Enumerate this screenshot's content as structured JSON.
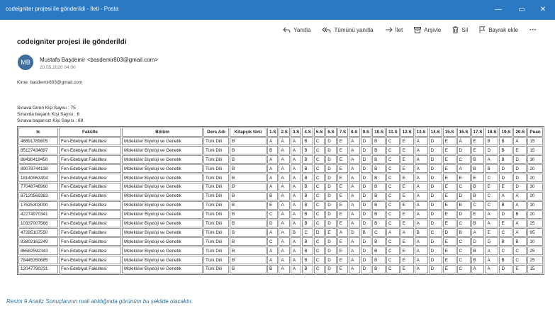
{
  "window": {
    "title": "codeigniter projesi ile gönderildi - İleti - Posta",
    "min_glyph": "—",
    "max_glyph": "▭",
    "close_glyph": "✕"
  },
  "toolbar": [
    {
      "label": "Yanıtla",
      "icon": "reply-icon"
    },
    {
      "label": "Tümünü yanıtla",
      "icon": "reply-all-icon"
    },
    {
      "label": "İlet",
      "icon": "forward-icon"
    },
    {
      "label": "Arşivle",
      "icon": "archive-icon"
    },
    {
      "label": "Sil",
      "icon": "trash-icon"
    },
    {
      "label": "Bayrak ekle",
      "icon": "flag-icon"
    },
    {
      "label": "···",
      "icon": "more-icon"
    }
  ],
  "message": {
    "subject": "codeigniter projesi ile gönderildi",
    "avatar_initials": "MB",
    "avatar_color": "#3d6e9f",
    "sender": "Mustafa Başdemir <basdemir803@gmail.com>",
    "date": "20.05.2020 04:00",
    "to": "Kime: basdemir803@gmail.com"
  },
  "summary": [
    "Sınava Giren Kişi Sayısı : 75",
    "Sınavda başarılı Kişi Sayısı : 6",
    "Sınava başarısız Kişi Sayısı : 69"
  ],
  "table": {
    "headers": [
      "tc",
      "Fakülte",
      "Bölüm",
      "Ders Adı",
      "Kitapçık türü",
      "1.S",
      "2.S",
      "3.S",
      "4.S",
      "5.S",
      "6.S",
      "7.S",
      "8.S",
      "9.S",
      "10.S",
      "11.S",
      "12.S",
      "13.S",
      "14.S",
      "15.S",
      "16.S",
      "17.S",
      "18.S",
      "19.S",
      "20.S",
      "Puan"
    ],
    "rows": [
      [
        "46891789805",
        "Fen-Edebiyat Fakültesi",
        "Moleküler Biyoloji ve Genetik",
        "Türk Dili",
        "B",
        "A",
        "A",
        "A",
        "B",
        "C",
        "D",
        "E",
        "A",
        "D",
        "B",
        "C",
        "E",
        "A",
        "D",
        "E",
        "A",
        "E",
        "B",
        "B",
        "A",
        "15"
      ],
      [
        "85127434897",
        "Fen-Edebiyat Fakültesi",
        "Moleküler Biyoloji ve Genetik",
        "Türk Dili",
        "B",
        "B",
        "A",
        "A",
        "B",
        "C",
        "D",
        "E",
        "A",
        "D",
        "B",
        "C",
        "E",
        "A",
        "D",
        "E",
        "D",
        "E",
        "D",
        "B",
        "E",
        "15"
      ],
      [
        "88430419450",
        "Fen-Edebiyat Fakültesi",
        "Moleküler Biyoloji ve Genetik",
        "Türk Dili",
        "B",
        "A",
        "A",
        "A",
        "B",
        "C",
        "D",
        "E",
        "A",
        "D",
        "B",
        "C",
        "E",
        "A",
        "D",
        "E",
        "C",
        "B",
        "A",
        "B",
        "D",
        "30"
      ],
      [
        "89078744138",
        "Fen-Edebiyat Fakültesi",
        "Moleküler Biyoloji ve Genetik",
        "Türk Dili",
        "B",
        "A",
        "A",
        "A",
        "B",
        "C",
        "D",
        "E",
        "A",
        "D",
        "B",
        "C",
        "E",
        "A",
        "D",
        "E",
        "A",
        "B",
        "B",
        "D",
        "D",
        "20"
      ],
      [
        "18140063404",
        "Fen-Edebiyat Fakültesi",
        "Moleküler Biyoloji ve Genetik",
        "Türk Dili",
        "B",
        "A",
        "A",
        "A",
        "B",
        "C",
        "D",
        "E",
        "A",
        "D",
        "B",
        "C",
        "E",
        "A",
        "D",
        "E",
        "E",
        "E",
        "C",
        "D",
        "D",
        "20"
      ],
      [
        "77048748960",
        "Fen-Edebiyat Fakültesi",
        "Moleküler Biyoloji ve Genetik",
        "Türk Dili",
        "B",
        "A",
        "A",
        "A",
        "B",
        "C",
        "D",
        "E",
        "A",
        "D",
        "B",
        "C",
        "E",
        "A",
        "D",
        "E",
        "C",
        "B",
        "E",
        "E",
        "D",
        "30"
      ],
      [
        "87120569383",
        "Fen-Edebiyat Fakültesi",
        "Moleküler Biyoloji ve Genetik",
        "Türk Dili",
        "B",
        "B",
        "A",
        "A",
        "B",
        "C",
        "D",
        "E",
        "A",
        "D",
        "B",
        "C",
        "E",
        "A",
        "D",
        "E",
        "D",
        "B",
        "C",
        "A",
        "A",
        "20"
      ],
      [
        "17625303000",
        "Fen-Edebiyat Fakültesi",
        "Moleküler Biyoloji ve Genetik",
        "Türk Dili",
        "B",
        "E",
        "A",
        "A",
        "B",
        "C",
        "D",
        "E",
        "A",
        "D",
        "B",
        "C",
        "E",
        "A",
        "D",
        "E",
        "B",
        "C",
        "C",
        "B",
        "A",
        "10"
      ],
      [
        "42274970341",
        "Fen-Edebiyat Fakültesi",
        "Moleküler Biyoloji ve Genetik",
        "Türk Dili",
        "B",
        "C",
        "A",
        "A",
        "B",
        "C",
        "D",
        "E",
        "A",
        "D",
        "B",
        "C",
        "E",
        "A",
        "D",
        "E",
        "D",
        "E",
        "A",
        "D",
        "B",
        "20"
      ],
      [
        "10337007566",
        "Fen-Edebiyat Fakültesi",
        "Moleküler Biyoloji ve Genetik",
        "Türk Dili",
        "B",
        "D",
        "A",
        "A",
        "B",
        "C",
        "D",
        "E",
        "A",
        "D",
        "B",
        "C",
        "E",
        "A",
        "D",
        "E",
        "C",
        "B",
        "A",
        "E",
        "A",
        "25"
      ],
      [
        "47285107550",
        "Fen-Edebiyat Fakültesi",
        "Moleküler Biyoloji ve Genetik",
        "Türk Dili",
        "B",
        "A",
        "A",
        "B",
        "C",
        "D",
        "E",
        "A",
        "D",
        "B",
        "C",
        "A",
        "A",
        "B",
        "C",
        "D",
        "B",
        "A",
        "E",
        "C",
        "A",
        "95"
      ],
      [
        "83802162249",
        "Fen-Edebiyat Fakültesi",
        "Moleküler Biyoloji ve Genetik",
        "Türk Dili",
        "B",
        "C",
        "A",
        "A",
        "B",
        "C",
        "D",
        "E",
        "A",
        "D",
        "B",
        "C",
        "E",
        "A",
        "D",
        "E",
        "C",
        "D",
        "D",
        "B",
        "B",
        "10"
      ],
      [
        "86582592343",
        "Fen-Edebiyat Fakültesi",
        "Moleküler Biyoloji ve Genetik",
        "Türk Dili",
        "B",
        "A",
        "A",
        "A",
        "B",
        "C",
        "D",
        "E",
        "A",
        "D",
        "B",
        "C",
        "E",
        "A",
        "D",
        "E",
        "C",
        "B",
        "A",
        "C",
        "C",
        "25"
      ],
      [
        "78445350685",
        "Fen-Edebiyat Fakültesi",
        "Moleküler Biyoloji ve Genetik",
        "Türk Dili",
        "B",
        "A",
        "A",
        "A",
        "B",
        "C",
        "D",
        "E",
        "A",
        "D",
        "B",
        "C",
        "E",
        "A",
        "D",
        "E",
        "C",
        "B",
        "A",
        "B",
        "C",
        "25"
      ],
      [
        "12047790231",
        "Fen-Edebiyat Fakültesi",
        "Moleküler Biyoloji ve Genetik",
        "Türk Dili",
        "B",
        "B",
        "A",
        "A",
        "B",
        "C",
        "D",
        "E",
        "A",
        "D",
        "B",
        "C",
        "E",
        "A",
        "D",
        "E",
        "C",
        "A",
        "A",
        "D",
        "E",
        "15"
      ]
    ]
  },
  "caption": "Resim 9 Analiz Sonuçlarının mail atıldığında görünüm bu şekilde olacaktır.",
  "colors": {
    "titlebar": "#2b79c2",
    "caption": "#2d6f95"
  }
}
